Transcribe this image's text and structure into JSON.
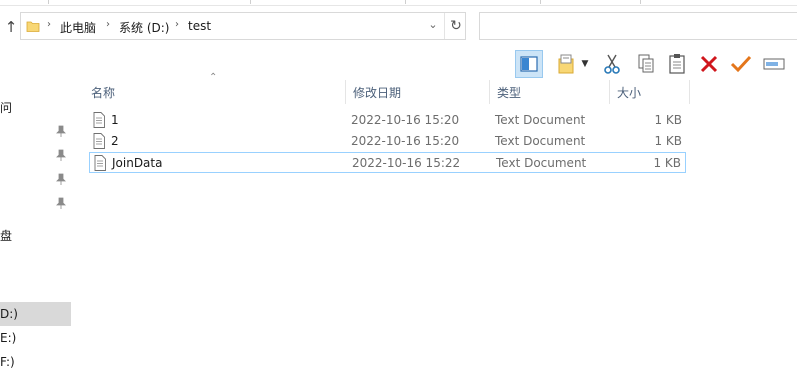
{
  "address_bar": {
    "crumbs": [
      "此电脑",
      "系统 (D:)",
      "test"
    ]
  },
  "toolbar": {
    "buttons": [
      "preview-pane",
      "new-item",
      "cut",
      "copy",
      "paste",
      "delete",
      "properties",
      "rename"
    ]
  },
  "nav_pane": {
    "items": [
      {
        "label": "问",
        "pinned": false
      },
      {
        "label": "",
        "pinned": true
      },
      {
        "label": "",
        "pinned": true
      },
      {
        "label": "",
        "pinned": true
      },
      {
        "label": "",
        "pinned": true
      },
      {
        "label": "盘",
        "pinned": false
      },
      {
        "label": "D:)",
        "pinned": false,
        "selected": true
      },
      {
        "label": "E:)",
        "pinned": false
      },
      {
        "label": "F:)",
        "pinned": false
      }
    ]
  },
  "file_list": {
    "columns": [
      "名称",
      "修改日期",
      "类型",
      "大小"
    ],
    "rows": [
      {
        "name": "1",
        "date": "2022-10-16 15:20",
        "type": "Text Document",
        "size": "1 KB"
      },
      {
        "name": "2",
        "date": "2022-10-16 15:20",
        "type": "Text Document",
        "size": "1 KB"
      },
      {
        "name": "JoinData",
        "date": "2022-10-16 15:22",
        "type": "Text Document",
        "size": "1 KB"
      }
    ]
  },
  "colors": {
    "accent_selected_bg": "#cce4f7",
    "focus_border": "#99d1ff",
    "delete_red": "#d0161c",
    "check_orange": "#e4761b"
  }
}
